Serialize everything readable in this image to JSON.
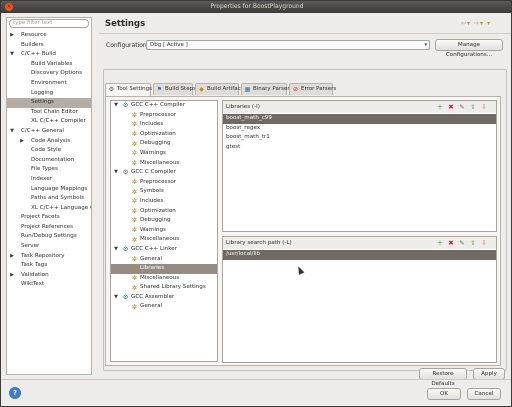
{
  "window": {
    "title": "Properties for BoostPlayground"
  },
  "sidebar": {
    "filter_placeholder": "type filter text",
    "items": [
      {
        "label": "Resource",
        "indent": 0,
        "expand": "collapsed"
      },
      {
        "label": "Builders",
        "indent": 0,
        "expand": "none"
      },
      {
        "label": "C/C++ Build",
        "indent": 0,
        "expand": "expanded"
      },
      {
        "label": "Build Variables",
        "indent": 1,
        "expand": "none"
      },
      {
        "label": "Discovery Options",
        "indent": 1,
        "expand": "none"
      },
      {
        "label": "Environment",
        "indent": 1,
        "expand": "none"
      },
      {
        "label": "Logging",
        "indent": 1,
        "expand": "none"
      },
      {
        "label": "Settings",
        "indent": 1,
        "expand": "none",
        "selected": true
      },
      {
        "label": "Tool Chain Editor",
        "indent": 1,
        "expand": "none"
      },
      {
        "label": "XL C/C++ Compiler",
        "indent": 1,
        "expand": "none"
      },
      {
        "label": "C/C++ General",
        "indent": 0,
        "expand": "expanded"
      },
      {
        "label": "Code Analysis",
        "indent": 1,
        "expand": "collapsed"
      },
      {
        "label": "Code Style",
        "indent": 1,
        "expand": "none"
      },
      {
        "label": "Documentation",
        "indent": 1,
        "expand": "none"
      },
      {
        "label": "File Types",
        "indent": 1,
        "expand": "none"
      },
      {
        "label": "Indexer",
        "indent": 1,
        "expand": "none"
      },
      {
        "label": "Language Mappings",
        "indent": 1,
        "expand": "none"
      },
      {
        "label": "Paths and Symbols",
        "indent": 1,
        "expand": "none"
      },
      {
        "label": "XL C/C++ Language Opti",
        "indent": 1,
        "expand": "none"
      },
      {
        "label": "Project Facets",
        "indent": 0,
        "expand": "none"
      },
      {
        "label": "Project References",
        "indent": 0,
        "expand": "none"
      },
      {
        "label": "Run/Debug Settings",
        "indent": 0,
        "expand": "none"
      },
      {
        "label": "Server",
        "indent": 0,
        "expand": "none"
      },
      {
        "label": "Task Repository",
        "indent": 0,
        "expand": "collapsed"
      },
      {
        "label": "Task Tags",
        "indent": 0,
        "expand": "none"
      },
      {
        "label": "Validation",
        "indent": 0,
        "expand": "collapsed"
      },
      {
        "label": "WikiText",
        "indent": 0,
        "expand": "none"
      }
    ]
  },
  "main": {
    "title": "Settings",
    "configuration_label": "Configuration:",
    "configuration_value": "Dbg  [ Active ]",
    "manage_button": "Manage Configurations...",
    "tabs": [
      {
        "label": "Tool Settings",
        "icon": "tool-settings-icon",
        "active": true
      },
      {
        "label": "Build Steps",
        "icon": "build-steps-icon"
      },
      {
        "label": "Build Artifact",
        "icon": "build-artifact-icon"
      },
      {
        "label": "Binary Parsers",
        "icon": "binary-parsers-icon"
      },
      {
        "label": "Error Parsers",
        "icon": "error-parsers-icon"
      }
    ],
    "tool_tree": [
      {
        "label": "GCC C++ Compiler",
        "indent": 0,
        "expand": "expanded",
        "icon": "tool"
      },
      {
        "label": "Preprocessor",
        "indent": 1,
        "icon": "gear"
      },
      {
        "label": "Includes",
        "indent": 1,
        "icon": "gear"
      },
      {
        "label": "Optimization",
        "indent": 1,
        "icon": "gear"
      },
      {
        "label": "Debugging",
        "indent": 1,
        "icon": "gear"
      },
      {
        "label": "Warnings",
        "indent": 1,
        "icon": "gear"
      },
      {
        "label": "Miscellaneous",
        "indent": 1,
        "icon": "gear"
      },
      {
        "label": "GCC C Compiler",
        "indent": 0,
        "expand": "expanded",
        "icon": "tool"
      },
      {
        "label": "Preprocessor",
        "indent": 1,
        "icon": "gear"
      },
      {
        "label": "Symbols",
        "indent": 1,
        "icon": "gear"
      },
      {
        "label": "Includes",
        "indent": 1,
        "icon": "gear"
      },
      {
        "label": "Optimization",
        "indent": 1,
        "icon": "gear"
      },
      {
        "label": "Debugging",
        "indent": 1,
        "icon": "gear"
      },
      {
        "label": "Warnings",
        "indent": 1,
        "icon": "gear"
      },
      {
        "label": "Miscellaneous",
        "indent": 1,
        "icon": "gear"
      },
      {
        "label": "GCC C++ Linker",
        "indent": 0,
        "expand": "expanded",
        "icon": "tool"
      },
      {
        "label": "General",
        "indent": 1,
        "icon": "gear"
      },
      {
        "label": "Libraries",
        "indent": 1,
        "icon": "gear",
        "selected": true
      },
      {
        "label": "Miscellaneous",
        "indent": 1,
        "icon": "gear"
      },
      {
        "label": "Shared Library Settings",
        "indent": 1,
        "icon": "gear"
      },
      {
        "label": "GCC Assembler",
        "indent": 0,
        "expand": "expanded",
        "icon": "tool"
      },
      {
        "label": "General",
        "indent": 1,
        "icon": "gear"
      }
    ],
    "libraries": {
      "header": "Libraries (-l)",
      "items": [
        "boost_math_c99",
        "boost_regex",
        "boost_math_tr1",
        "gtest"
      ],
      "selected_index": 0
    },
    "library_paths": {
      "header": "Library search path (-L)",
      "items": [
        "/usr/local/lib"
      ],
      "selected_index": 0
    },
    "restore_defaults": "Restore Defaults",
    "apply": "Apply"
  },
  "footer": {
    "help": "?",
    "ok": "OK",
    "cancel": "Cancel"
  }
}
